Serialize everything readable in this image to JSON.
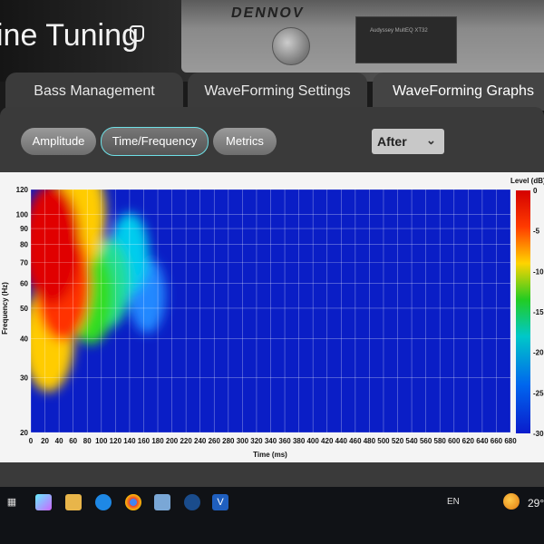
{
  "header": {
    "title": "ine Tuning",
    "device_brand": "DENNOV",
    "device_panel_text": "Audyssey MultEQ XT32"
  },
  "tabs": [
    {
      "label": "Bass Management"
    },
    {
      "label": "WaveForming Settings"
    },
    {
      "label": "WaveForming Graphs"
    }
  ],
  "toolbar": {
    "amplitude_label": "Amplitude",
    "timefreq_label": "Time/Frequency",
    "metrics_label": "Metrics",
    "view_select_value": "After"
  },
  "chart_data": {
    "type": "heatmap",
    "xlabel": "Time (ms)",
    "ylabel": "Frequency (Hz)",
    "x_ticks": [
      0,
      20,
      40,
      60,
      80,
      100,
      120,
      140,
      160,
      180,
      200,
      220,
      240,
      260,
      280,
      300,
      320,
      340,
      360,
      380,
      400,
      420,
      440,
      460,
      480,
      500,
      520,
      540,
      560,
      580,
      600,
      620,
      640,
      660,
      680
    ],
    "y_ticks": [
      20,
      30,
      40,
      50,
      60,
      70,
      80,
      90,
      100,
      120
    ],
    "xlim": [
      0,
      680
    ],
    "ylim": [
      20,
      120
    ],
    "y_scale": "log",
    "colorbar": {
      "label": "Level (dB)",
      "ticks": [
        "0",
        "-5",
        "-10",
        "-15",
        "-20",
        "-25",
        "-30"
      ],
      "range": [
        -30,
        0
      ]
    },
    "hotspots": [
      {
        "t": 30,
        "f": 80,
        "level": 0
      },
      {
        "t": 45,
        "f": 60,
        "level": -2
      },
      {
        "t": 25,
        "f": 40,
        "level": -6
      },
      {
        "t": 70,
        "f": 100,
        "level": -6
      },
      {
        "t": 85,
        "f": 55,
        "level": -10
      },
      {
        "t": 110,
        "f": 60,
        "level": -14
      },
      {
        "t": 140,
        "f": 75,
        "level": -18
      },
      {
        "t": 165,
        "f": 55,
        "level": -20
      }
    ]
  },
  "taskbar": {
    "language": "EN",
    "temperature": "29°"
  }
}
